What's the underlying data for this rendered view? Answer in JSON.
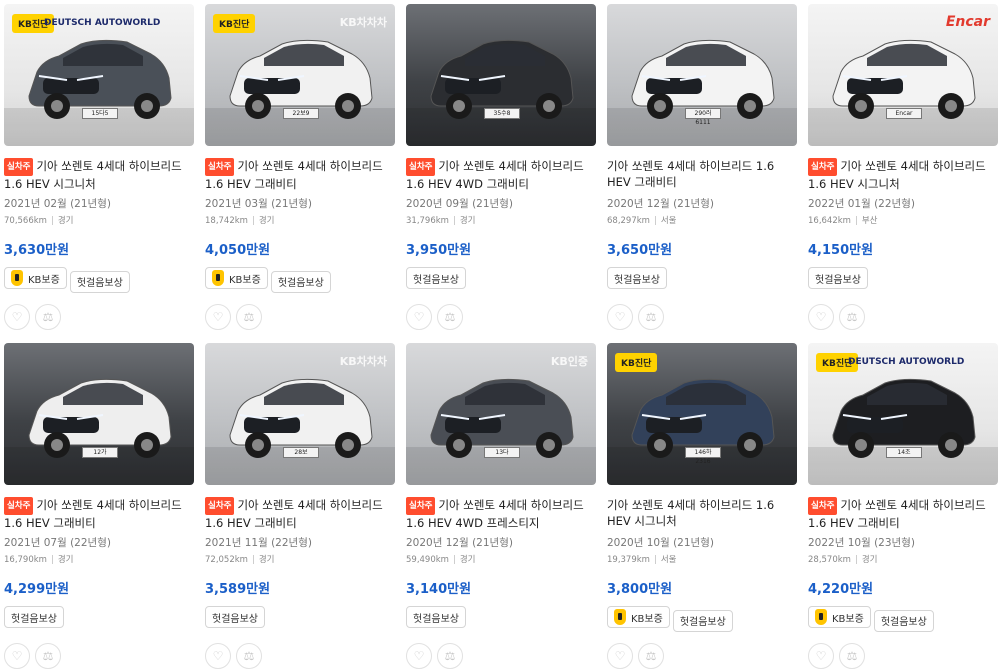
{
  "labels": {
    "self_owned": "실차주",
    "kb_warranty": "KB보증",
    "defect_comp": "헛걸음보상",
    "kb_diag": "KB진단"
  },
  "photo_logos": {
    "deutsch": "DEUTSCH AUTOWORLD",
    "chachacha": "KB차차차",
    "encar": "Encar",
    "kb_cert": "KB인증"
  },
  "cars": [
    {
      "title": "기아 쏘렌토 4세대 하이브리드 1.6 HEV 시그니처",
      "self_owned": true,
      "year": "2021년 02월 (21년형)",
      "km": "70,566km",
      "region": "경기",
      "price": "3,630만원",
      "kb_warranty": true,
      "plate": "15다5"
    },
    {
      "title": "기아 쏘렌토 4세대 하이브리드 1.6 HEV 그래비티",
      "self_owned": true,
      "year": "2021년 03월 (21년형)",
      "km": "18,742km",
      "region": "경기",
      "price": "4,050만원",
      "kb_warranty": true,
      "plate": "22보9"
    },
    {
      "title": "기아 쏘렌토 4세대 하이브리드 1.6 HEV 4WD 그래비티",
      "self_owned": true,
      "year": "2020년 09월 (21년형)",
      "km": "31,796km",
      "region": "경기",
      "price": "3,950만원",
      "kb_warranty": false,
      "plate": "35수8"
    },
    {
      "title": "기아 쏘렌토 4세대 하이브리드 1.6 HEV 그래비티",
      "self_owned": false,
      "year": "2020년 12월 (21년형)",
      "km": "68,297km",
      "region": "서울",
      "price": "3,650만원",
      "kb_warranty": false,
      "plate": "290러 6111"
    },
    {
      "title": "기아 쏘렌토 4세대 하이브리드 1.6 HEV 시그니처",
      "self_owned": true,
      "year": "2022년 01월 (22년형)",
      "km": "16,642km",
      "region": "부산",
      "price": "4,150만원",
      "kb_warranty": false,
      "plate": "Encar"
    },
    {
      "title": "기아 쏘렌토 4세대 하이브리드 1.6 HEV 그래비티",
      "self_owned": true,
      "year": "2021년 07월 (22년형)",
      "km": "16,790km",
      "region": "경기",
      "price": "4,299만원",
      "kb_warranty": false,
      "plate": "12가"
    },
    {
      "title": "기아 쏘렌토 4세대 하이브리드 1.6 HEV 그래비티",
      "self_owned": true,
      "year": "2021년 11월 (22년형)",
      "km": "72,052km",
      "region": "경기",
      "price": "3,589만원",
      "kb_warranty": false,
      "plate": "28보"
    },
    {
      "title": "기아 쏘렌토 4세대 하이브리드 1.6 HEV 4WD 프레스티지",
      "self_owned": true,
      "year": "2020년 12월 (21년형)",
      "km": "59,490km",
      "region": "경기",
      "price": "3,140만원",
      "kb_warranty": false,
      "plate": "13다"
    },
    {
      "title": "기아 쏘렌토 4세대 하이브리드 1.6 HEV 시그니처",
      "self_owned": false,
      "year": "2020년 10월 (21년형)",
      "km": "19,379km",
      "region": "서울",
      "price": "3,800만원",
      "kb_warranty": true,
      "plate": "146하 2316"
    },
    {
      "title": "기아 쏘렌토 4세대 하이브리드 1.6 HEV 그래비티",
      "self_owned": true,
      "year": "2022년 10월 (23년형)",
      "km": "28,570km",
      "region": "경기",
      "price": "4,220만원",
      "kb_warranty": true,
      "plate": "14조"
    }
  ]
}
